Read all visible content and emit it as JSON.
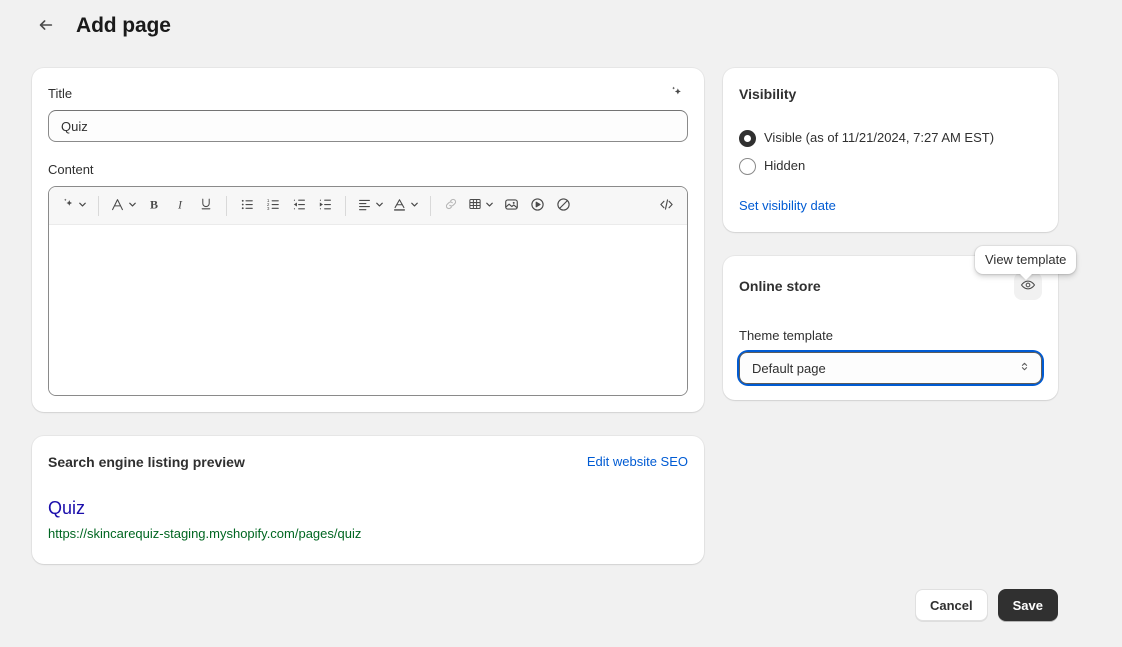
{
  "header": {
    "back_icon": "arrow-left-icon",
    "title": "Add page"
  },
  "main": {
    "title_field": {
      "label": "Title",
      "value": "Quiz",
      "placeholder": "",
      "magic_icon": "sparkle-icon"
    },
    "content_field": {
      "label": "Content",
      "value": "",
      "toolbar": [
        {
          "name": "magic-tools",
          "icon": "sparkle-icon",
          "has_chevron": true,
          "disabled": false
        },
        {
          "name": "separator",
          "icon": "divider",
          "disabled": false
        },
        {
          "name": "text-style",
          "icon": "font-icon",
          "has_chevron": true,
          "disabled": false
        },
        {
          "name": "bold",
          "icon": "bold-icon",
          "disabled": false
        },
        {
          "name": "italic",
          "icon": "italic-icon",
          "disabled": false
        },
        {
          "name": "underline",
          "icon": "underline-icon",
          "disabled": false
        },
        {
          "name": "separator",
          "icon": "divider",
          "disabled": false
        },
        {
          "name": "bulleted-list",
          "icon": "bulleted-list-icon",
          "disabled": false
        },
        {
          "name": "numbered-list",
          "icon": "numbered-list-icon",
          "disabled": false
        },
        {
          "name": "outdent",
          "icon": "outdent-icon",
          "disabled": false
        },
        {
          "name": "indent",
          "icon": "indent-icon",
          "disabled": false
        },
        {
          "name": "separator",
          "icon": "divider",
          "disabled": false
        },
        {
          "name": "text-align",
          "icon": "align-left-icon",
          "has_chevron": true,
          "disabled": false
        },
        {
          "name": "text-color",
          "icon": "text-color-icon",
          "has_chevron": true,
          "disabled": false
        },
        {
          "name": "separator",
          "icon": "divider",
          "disabled": false
        },
        {
          "name": "insert-link",
          "icon": "link-icon",
          "disabled": true
        },
        {
          "name": "insert-table",
          "icon": "table-icon",
          "has_chevron": true,
          "disabled": false
        },
        {
          "name": "insert-image",
          "icon": "image-icon",
          "disabled": false
        },
        {
          "name": "insert-video",
          "icon": "video-icon",
          "disabled": false
        },
        {
          "name": "clear-formatting",
          "icon": "no-symbol-icon",
          "disabled": false
        },
        {
          "name": "view-html",
          "icon": "code-icon",
          "disabled": false
        }
      ]
    }
  },
  "seo": {
    "title": "Search engine listing preview",
    "edit_link": "Edit website SEO",
    "preview_title": "Quiz",
    "preview_url": "https://skincarequiz-staging.myshopify.com/pages/quiz"
  },
  "visibility": {
    "title": "Visibility",
    "options": [
      {
        "label": "Visible (as of 11/21/2024, 7:27 AM EST)",
        "selected": true
      },
      {
        "label": "Hidden",
        "selected": false
      }
    ],
    "set_date_link": "Set visibility date"
  },
  "online_store": {
    "title": "Online store",
    "view_template_icon": "eye-icon",
    "tooltip": "View template",
    "template_label": "Theme template",
    "template_value": "Default page",
    "chevron_icon": "chevron-up-down-icon"
  },
  "footer": {
    "cancel_label": "Cancel",
    "save_label": "Save"
  },
  "colors": {
    "background": "#f1f1f1",
    "card": "#ffffff",
    "text": "#303030",
    "link": "#005bd3",
    "focus_ring": "#005bd3",
    "seo_title": "#1a0dab",
    "seo_url": "#006621",
    "primary_button": "#303030"
  }
}
